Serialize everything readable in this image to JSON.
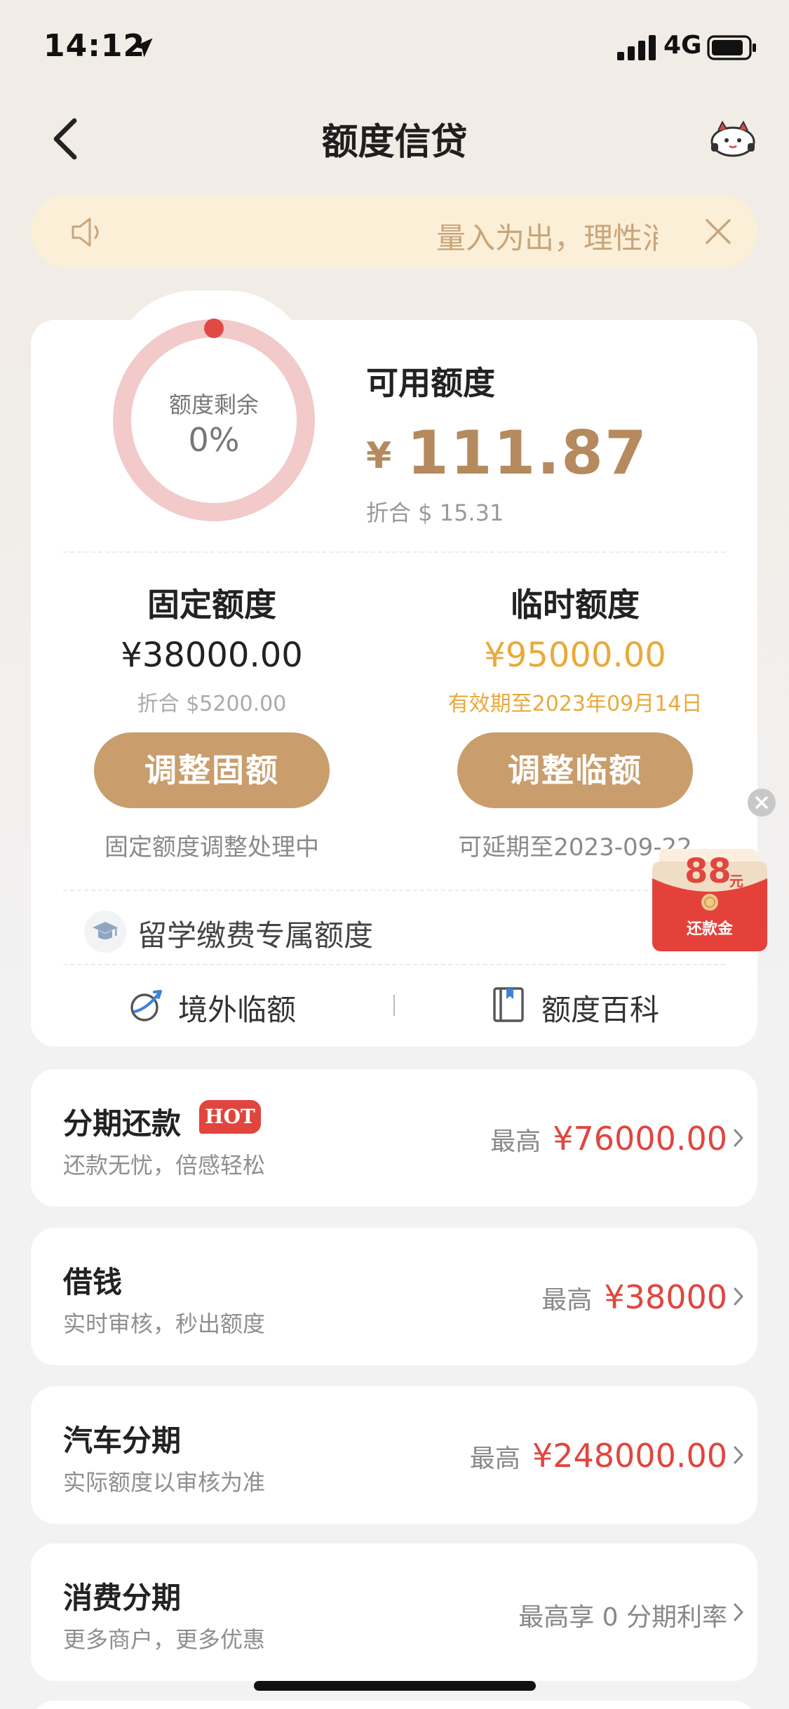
{
  "status_bar": {
    "time": "14:12",
    "network": "4G"
  },
  "header": {
    "title": "额度信贷"
  },
  "notice": {
    "text": "量入为出，理性消费"
  },
  "credit": {
    "ring_label": "额度剩余",
    "ring_value": "0%",
    "ring_remaining_fraction": 0,
    "available_label": "可用额度",
    "currency_symbol": "¥",
    "available_amount": "111.87",
    "available_converted": "折合 $ 15.31",
    "fixed": {
      "title": "固定额度",
      "amount": "¥38000.00",
      "converted": "折合 $5200.00",
      "button": "调整固额",
      "note": "固定额度调整处理中"
    },
    "temporary": {
      "title": "临时额度",
      "amount": "¥95000.00",
      "validity": "有效期至2023年09月14日",
      "button": "调整临额",
      "note": "可延期至2023-09-22"
    },
    "study_abroad": "留学缴费专属额度",
    "links": [
      {
        "label": "境外临额",
        "icon": "plane-globe-icon"
      },
      {
        "label": "额度百科",
        "icon": "book-icon"
      }
    ]
  },
  "red_packet": {
    "amount": "88",
    "unit": "元",
    "label": "还款金"
  },
  "products": [
    {
      "title": "分期还款",
      "badge": "HOT",
      "subtitle": "还款无忧，倍感轻松",
      "max_label": "最高",
      "amount": "¥76000.00"
    },
    {
      "title": "借钱",
      "subtitle": "实时审核，秒出额度",
      "max_label": "最高",
      "amount": "¥38000"
    },
    {
      "title": "汽车分期",
      "subtitle": "实际额度以审核为准",
      "max_label": "最高",
      "amount": "¥248000.00"
    },
    {
      "title": "消费分期",
      "subtitle": "更多商户，更多优惠",
      "right_text": "最高享 0 分期利率"
    }
  ],
  "colors": {
    "accent": "#c99d6c",
    "gold_text": "#b58a5e",
    "temp_amount": "#e9a93b",
    "red": "#e0463e",
    "ring": "#f2caca",
    "ring_dot": "#e04a45"
  }
}
